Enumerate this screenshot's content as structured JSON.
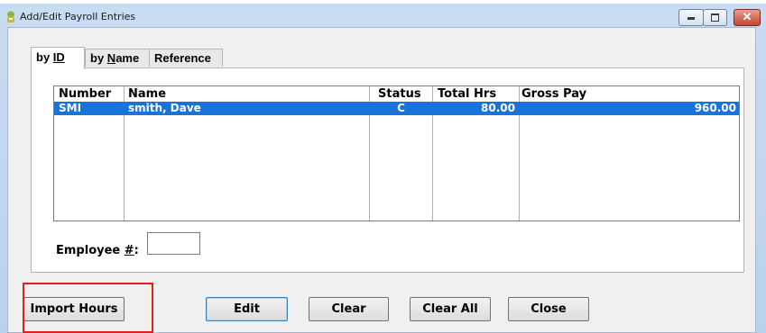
{
  "window": {
    "title": "Add/Edit Payroll Entries",
    "icon": "app-icon",
    "controls": {
      "minimize": "minimize-icon",
      "maximize": "maximize-icon",
      "close": "close-icon"
    }
  },
  "tabs": [
    {
      "pre": "by ",
      "ul": "ID",
      "post": ""
    },
    {
      "pre": "by ",
      "ul": "N",
      "post": "ame"
    },
    {
      "pre": "",
      "ul": "",
      "post": "Reference"
    }
  ],
  "grid": {
    "columns": [
      "Number",
      "Name",
      "Status",
      "Total Hrs",
      "Gross Pay"
    ],
    "rows": [
      {
        "number": "SMI",
        "name": "smith, Dave",
        "status": "C",
        "total_hrs": "80.00",
        "gross_pay": "960.00"
      }
    ],
    "selection_color": "#1a73d9"
  },
  "employee": {
    "label_pre": "Employee ",
    "label_ul": "#",
    "label_post": ":",
    "value": ""
  },
  "buttons": {
    "import_hours": "Import Hours",
    "edit": "Edit",
    "clear": "Clear",
    "clear_all": "Clear All",
    "close": "Close"
  },
  "annotation": {
    "color": "#e02020"
  }
}
